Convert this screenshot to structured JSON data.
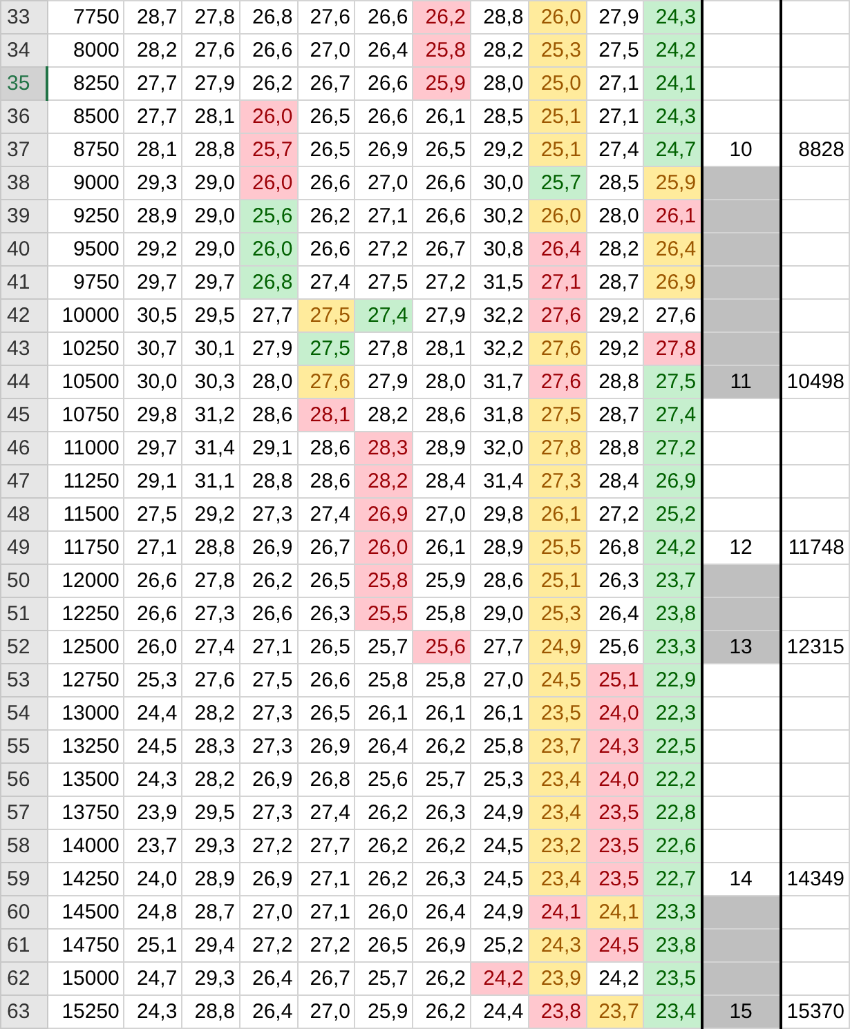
{
  "rows": [
    {
      "header": "33",
      "selected": false,
      "count": "7750",
      "cells": [
        {
          "text": "28,7"
        },
        {
          "text": "27,8"
        },
        {
          "text": "26,8"
        },
        {
          "text": "27,6"
        },
        {
          "text": "26,6"
        },
        {
          "text": "26,2",
          "color": "#ffc7ce"
        },
        {
          "text": "28,8"
        },
        {
          "text": "26,0",
          "color": "#ffeb9c"
        },
        {
          "text": "27,9"
        },
        {
          "text": "24,3",
          "color": "#c6efce"
        }
      ],
      "marker": {
        "shaded": false
      },
      "total": {}
    },
    {
      "header": "34",
      "selected": false,
      "count": "8000",
      "cells": [
        {
          "text": "28,2"
        },
        {
          "text": "27,6"
        },
        {
          "text": "26,6"
        },
        {
          "text": "27,0"
        },
        {
          "text": "26,4"
        },
        {
          "text": "25,8",
          "color": "#ffc7ce"
        },
        {
          "text": "28,2"
        },
        {
          "text": "25,3",
          "color": "#ffeb9c"
        },
        {
          "text": "27,5"
        },
        {
          "text": "24,2",
          "color": "#c6efce"
        }
      ],
      "marker": {
        "shaded": false
      },
      "total": {}
    },
    {
      "header": "35",
      "selected": true,
      "count": "8250",
      "cells": [
        {
          "text": "27,7"
        },
        {
          "text": "27,9"
        },
        {
          "text": "26,2"
        },
        {
          "text": "26,7"
        },
        {
          "text": "26,6"
        },
        {
          "text": "25,9",
          "color": "#ffc7ce"
        },
        {
          "text": "28,0"
        },
        {
          "text": "25,0",
          "color": "#ffeb9c"
        },
        {
          "text": "27,1"
        },
        {
          "text": "24,1",
          "color": "#c6efce"
        }
      ],
      "marker": {
        "shaded": false
      },
      "total": {}
    },
    {
      "header": "36",
      "selected": false,
      "count": "8500",
      "cells": [
        {
          "text": "27,7"
        },
        {
          "text": "28,1"
        },
        {
          "text": "26,0",
          "color": "#ffc7ce"
        },
        {
          "text": "26,5"
        },
        {
          "text": "26,6"
        },
        {
          "text": "26,1"
        },
        {
          "text": "28,5"
        },
        {
          "text": "25,1",
          "color": "#ffeb9c"
        },
        {
          "text": "27,1"
        },
        {
          "text": "24,3",
          "color": "#c6efce"
        }
      ],
      "marker": {
        "shaded": false
      },
      "total": {}
    },
    {
      "header": "37",
      "selected": false,
      "count": "8750",
      "cells": [
        {
          "text": "28,1"
        },
        {
          "text": "28,8"
        },
        {
          "text": "25,7",
          "color": "#ffc7ce"
        },
        {
          "text": "26,5"
        },
        {
          "text": "26,9"
        },
        {
          "text": "26,5"
        },
        {
          "text": "29,2"
        },
        {
          "text": "25,1",
          "color": "#ffeb9c"
        },
        {
          "text": "27,4"
        },
        {
          "text": "24,7",
          "color": "#c6efce"
        }
      ],
      "marker": {
        "text": "10",
        "shaded": false
      },
      "total": {
        "text": "8828"
      }
    },
    {
      "header": "38",
      "selected": false,
      "count": "9000",
      "cells": [
        {
          "text": "29,3"
        },
        {
          "text": "29,0"
        },
        {
          "text": "26,0",
          "color": "#ffc7ce"
        },
        {
          "text": "26,6"
        },
        {
          "text": "27,0"
        },
        {
          "text": "26,6"
        },
        {
          "text": "30,0"
        },
        {
          "text": "25,7",
          "color": "#c6efce"
        },
        {
          "text": "28,5"
        },
        {
          "text": "25,9",
          "color": "#ffeb9c"
        }
      ],
      "marker": {
        "shaded": true
      },
      "total": {}
    },
    {
      "header": "39",
      "selected": false,
      "count": "9250",
      "cells": [
        {
          "text": "28,9"
        },
        {
          "text": "29,0"
        },
        {
          "text": "25,6",
          "color": "#c6efce"
        },
        {
          "text": "26,2"
        },
        {
          "text": "27,1"
        },
        {
          "text": "26,6"
        },
        {
          "text": "30,2"
        },
        {
          "text": "26,0",
          "color": "#ffeb9c"
        },
        {
          "text": "28,0"
        },
        {
          "text": "26,1",
          "color": "#ffc7ce"
        }
      ],
      "marker": {
        "shaded": true
      },
      "total": {}
    },
    {
      "header": "40",
      "selected": false,
      "count": "9500",
      "cells": [
        {
          "text": "29,2"
        },
        {
          "text": "29,0"
        },
        {
          "text": "26,0",
          "color": "#c6efce"
        },
        {
          "text": "26,6"
        },
        {
          "text": "27,2"
        },
        {
          "text": "26,7"
        },
        {
          "text": "30,8"
        },
        {
          "text": "26,4",
          "color": "#ffc7ce"
        },
        {
          "text": "28,2"
        },
        {
          "text": "26,4",
          "color": "#ffeb9c"
        }
      ],
      "marker": {
        "shaded": true
      },
      "total": {}
    },
    {
      "header": "41",
      "selected": false,
      "count": "9750",
      "cells": [
        {
          "text": "29,7"
        },
        {
          "text": "29,7"
        },
        {
          "text": "26,8",
          "color": "#c6efce"
        },
        {
          "text": "27,4"
        },
        {
          "text": "27,5"
        },
        {
          "text": "27,2"
        },
        {
          "text": "31,5"
        },
        {
          "text": "27,1",
          "color": "#ffc7ce"
        },
        {
          "text": "28,7"
        },
        {
          "text": "26,9",
          "color": "#ffeb9c"
        }
      ],
      "marker": {
        "shaded": true
      },
      "total": {}
    },
    {
      "header": "42",
      "selected": false,
      "count": "10000",
      "cells": [
        {
          "text": "30,5"
        },
        {
          "text": "29,5"
        },
        {
          "text": "27,7"
        },
        {
          "text": "27,5",
          "color": "#ffeb9c"
        },
        {
          "text": "27,4",
          "color": "#c6efce"
        },
        {
          "text": "27,9"
        },
        {
          "text": "32,2"
        },
        {
          "text": "27,6",
          "color": "#ffc7ce"
        },
        {
          "text": "29,2"
        },
        {
          "text": "27,6"
        }
      ],
      "marker": {
        "shaded": true
      },
      "total": {}
    },
    {
      "header": "43",
      "selected": false,
      "count": "10250",
      "cells": [
        {
          "text": "30,7"
        },
        {
          "text": "30,1"
        },
        {
          "text": "27,9"
        },
        {
          "text": "27,5",
          "color": "#c6efce"
        },
        {
          "text": "27,8"
        },
        {
          "text": "28,1"
        },
        {
          "text": "32,2"
        },
        {
          "text": "27,6",
          "color": "#ffeb9c"
        },
        {
          "text": "29,2"
        },
        {
          "text": "27,8",
          "color": "#ffc7ce"
        }
      ],
      "marker": {
        "shaded": true
      },
      "total": {}
    },
    {
      "header": "44",
      "selected": false,
      "count": "10500",
      "cells": [
        {
          "text": "30,0"
        },
        {
          "text": "30,3"
        },
        {
          "text": "28,0"
        },
        {
          "text": "27,6",
          "color": "#ffeb9c"
        },
        {
          "text": "27,9"
        },
        {
          "text": "28,0"
        },
        {
          "text": "31,7"
        },
        {
          "text": "27,6",
          "color": "#ffc7ce"
        },
        {
          "text": "28,8"
        },
        {
          "text": "27,5",
          "color": "#c6efce"
        }
      ],
      "marker": {
        "text": "11",
        "shaded": true
      },
      "total": {
        "text": "10498"
      }
    },
    {
      "header": "45",
      "selected": false,
      "count": "10750",
      "cells": [
        {
          "text": "29,8"
        },
        {
          "text": "31,2"
        },
        {
          "text": "28,6"
        },
        {
          "text": "28,1",
          "color": "#ffc7ce"
        },
        {
          "text": "28,2"
        },
        {
          "text": "28,6"
        },
        {
          "text": "31,8"
        },
        {
          "text": "27,5",
          "color": "#ffeb9c"
        },
        {
          "text": "28,7"
        },
        {
          "text": "27,4",
          "color": "#c6efce"
        }
      ],
      "marker": {
        "shaded": false
      },
      "total": {}
    },
    {
      "header": "46",
      "selected": false,
      "count": "11000",
      "cells": [
        {
          "text": "29,7"
        },
        {
          "text": "31,4"
        },
        {
          "text": "29,1"
        },
        {
          "text": "28,6"
        },
        {
          "text": "28,3",
          "color": "#ffc7ce"
        },
        {
          "text": "28,9"
        },
        {
          "text": "32,0"
        },
        {
          "text": "27,8",
          "color": "#ffeb9c"
        },
        {
          "text": "28,8"
        },
        {
          "text": "27,2",
          "color": "#c6efce"
        }
      ],
      "marker": {
        "shaded": false
      },
      "total": {}
    },
    {
      "header": "47",
      "selected": false,
      "count": "11250",
      "cells": [
        {
          "text": "29,1"
        },
        {
          "text": "31,1"
        },
        {
          "text": "28,8"
        },
        {
          "text": "28,6"
        },
        {
          "text": "28,2",
          "color": "#ffc7ce"
        },
        {
          "text": "28,4"
        },
        {
          "text": "31,4"
        },
        {
          "text": "27,3",
          "color": "#ffeb9c"
        },
        {
          "text": "28,4"
        },
        {
          "text": "26,9",
          "color": "#c6efce"
        }
      ],
      "marker": {
        "shaded": false
      },
      "total": {}
    },
    {
      "header": "48",
      "selected": false,
      "count": "11500",
      "cells": [
        {
          "text": "27,5"
        },
        {
          "text": "29,2"
        },
        {
          "text": "27,3"
        },
        {
          "text": "27,4"
        },
        {
          "text": "26,9",
          "color": "#ffc7ce"
        },
        {
          "text": "27,0"
        },
        {
          "text": "29,8"
        },
        {
          "text": "26,1",
          "color": "#ffeb9c"
        },
        {
          "text": "27,2"
        },
        {
          "text": "25,2",
          "color": "#c6efce"
        }
      ],
      "marker": {
        "shaded": false
      },
      "total": {}
    },
    {
      "header": "49",
      "selected": false,
      "count": "11750",
      "cells": [
        {
          "text": "27,1"
        },
        {
          "text": "28,8"
        },
        {
          "text": "26,9"
        },
        {
          "text": "26,7"
        },
        {
          "text": "26,0",
          "color": "#ffc7ce"
        },
        {
          "text": "26,1"
        },
        {
          "text": "28,9"
        },
        {
          "text": "25,5",
          "color": "#ffeb9c"
        },
        {
          "text": "26,8"
        },
        {
          "text": "24,2",
          "color": "#c6efce"
        }
      ],
      "marker": {
        "text": "12",
        "shaded": false
      },
      "total": {
        "text": "11748"
      }
    },
    {
      "header": "50",
      "selected": false,
      "count": "12000",
      "cells": [
        {
          "text": "26,6"
        },
        {
          "text": "27,8"
        },
        {
          "text": "26,2"
        },
        {
          "text": "26,5"
        },
        {
          "text": "25,8",
          "color": "#ffc7ce"
        },
        {
          "text": "25,9"
        },
        {
          "text": "28,6"
        },
        {
          "text": "25,1",
          "color": "#ffeb9c"
        },
        {
          "text": "26,3"
        },
        {
          "text": "23,7",
          "color": "#c6efce"
        }
      ],
      "marker": {
        "shaded": true
      },
      "total": {}
    },
    {
      "header": "51",
      "selected": false,
      "count": "12250",
      "cells": [
        {
          "text": "26,6"
        },
        {
          "text": "27,3"
        },
        {
          "text": "26,6"
        },
        {
          "text": "26,3"
        },
        {
          "text": "25,5",
          "color": "#ffc7ce"
        },
        {
          "text": "25,8"
        },
        {
          "text": "29,0"
        },
        {
          "text": "25,3",
          "color": "#ffeb9c"
        },
        {
          "text": "26,4"
        },
        {
          "text": "23,8",
          "color": "#c6efce"
        }
      ],
      "marker": {
        "shaded": true
      },
      "total": {}
    },
    {
      "header": "52",
      "selected": false,
      "count": "12500",
      "cells": [
        {
          "text": "26,0"
        },
        {
          "text": "27,4"
        },
        {
          "text": "27,1"
        },
        {
          "text": "26,5"
        },
        {
          "text": "25,7"
        },
        {
          "text": "25,6",
          "color": "#ffc7ce"
        },
        {
          "text": "27,7"
        },
        {
          "text": "24,9",
          "color": "#ffeb9c"
        },
        {
          "text": "25,6"
        },
        {
          "text": "23,3",
          "color": "#c6efce"
        }
      ],
      "marker": {
        "text": "13",
        "shaded": true
      },
      "total": {
        "text": "12315"
      }
    },
    {
      "header": "53",
      "selected": false,
      "count": "12750",
      "cells": [
        {
          "text": "25,3"
        },
        {
          "text": "27,6"
        },
        {
          "text": "27,5"
        },
        {
          "text": "26,6"
        },
        {
          "text": "25,8"
        },
        {
          "text": "25,8"
        },
        {
          "text": "27,0"
        },
        {
          "text": "24,5",
          "color": "#ffeb9c"
        },
        {
          "text": "25,1",
          "color": "#ffc7ce"
        },
        {
          "text": "22,9",
          "color": "#c6efce"
        }
      ],
      "marker": {
        "shaded": false
      },
      "total": {}
    },
    {
      "header": "54",
      "selected": false,
      "count": "13000",
      "cells": [
        {
          "text": "24,4"
        },
        {
          "text": "28,2"
        },
        {
          "text": "27,3"
        },
        {
          "text": "26,5"
        },
        {
          "text": "26,1"
        },
        {
          "text": "26,1"
        },
        {
          "text": "26,1"
        },
        {
          "text": "23,5",
          "color": "#ffeb9c"
        },
        {
          "text": "24,0",
          "color": "#ffc7ce"
        },
        {
          "text": "22,3",
          "color": "#c6efce"
        }
      ],
      "marker": {
        "shaded": false
      },
      "total": {}
    },
    {
      "header": "55",
      "selected": false,
      "count": "13250",
      "cells": [
        {
          "text": "24,5"
        },
        {
          "text": "28,3"
        },
        {
          "text": "27,3"
        },
        {
          "text": "26,9"
        },
        {
          "text": "26,4"
        },
        {
          "text": "26,2"
        },
        {
          "text": "25,8"
        },
        {
          "text": "23,7",
          "color": "#ffeb9c"
        },
        {
          "text": "24,3",
          "color": "#ffc7ce"
        },
        {
          "text": "22,5",
          "color": "#c6efce"
        }
      ],
      "marker": {
        "shaded": false
      },
      "total": {}
    },
    {
      "header": "56",
      "selected": false,
      "count": "13500",
      "cells": [
        {
          "text": "24,3"
        },
        {
          "text": "28,2"
        },
        {
          "text": "26,9"
        },
        {
          "text": "26,8"
        },
        {
          "text": "25,6"
        },
        {
          "text": "25,7"
        },
        {
          "text": "25,3"
        },
        {
          "text": "23,4",
          "color": "#ffeb9c"
        },
        {
          "text": "24,0",
          "color": "#ffc7ce"
        },
        {
          "text": "22,2",
          "color": "#c6efce"
        }
      ],
      "marker": {
        "shaded": false
      },
      "total": {}
    },
    {
      "header": "57",
      "selected": false,
      "count": "13750",
      "cells": [
        {
          "text": "23,9"
        },
        {
          "text": "29,5"
        },
        {
          "text": "27,3"
        },
        {
          "text": "27,4"
        },
        {
          "text": "26,2"
        },
        {
          "text": "26,3"
        },
        {
          "text": "24,9"
        },
        {
          "text": "23,4",
          "color": "#ffeb9c"
        },
        {
          "text": "23,5",
          "color": "#ffc7ce"
        },
        {
          "text": "22,8",
          "color": "#c6efce"
        }
      ],
      "marker": {
        "shaded": false
      },
      "total": {}
    },
    {
      "header": "58",
      "selected": false,
      "count": "14000",
      "cells": [
        {
          "text": "23,7"
        },
        {
          "text": "29,3"
        },
        {
          "text": "27,2"
        },
        {
          "text": "27,7"
        },
        {
          "text": "26,2"
        },
        {
          "text": "26,2"
        },
        {
          "text": "24,5"
        },
        {
          "text": "23,2",
          "color": "#ffeb9c"
        },
        {
          "text": "23,5",
          "color": "#ffc7ce"
        },
        {
          "text": "22,6",
          "color": "#c6efce"
        }
      ],
      "marker": {
        "shaded": false
      },
      "total": {}
    },
    {
      "header": "59",
      "selected": false,
      "count": "14250",
      "cells": [
        {
          "text": "24,0"
        },
        {
          "text": "28,9"
        },
        {
          "text": "26,9"
        },
        {
          "text": "27,1"
        },
        {
          "text": "26,2"
        },
        {
          "text": "26,3"
        },
        {
          "text": "24,5"
        },
        {
          "text": "23,4",
          "color": "#ffeb9c"
        },
        {
          "text": "23,5",
          "color": "#ffc7ce"
        },
        {
          "text": "22,7",
          "color": "#c6efce"
        }
      ],
      "marker": {
        "text": "14",
        "shaded": false
      },
      "total": {
        "text": "14349"
      }
    },
    {
      "header": "60",
      "selected": false,
      "count": "14500",
      "cells": [
        {
          "text": "24,8"
        },
        {
          "text": "28,7"
        },
        {
          "text": "27,0"
        },
        {
          "text": "27,1"
        },
        {
          "text": "26,0"
        },
        {
          "text": "26,4"
        },
        {
          "text": "24,9"
        },
        {
          "text": "24,1",
          "color": "#ffc7ce"
        },
        {
          "text": "24,1",
          "color": "#ffeb9c"
        },
        {
          "text": "23,3",
          "color": "#c6efce"
        }
      ],
      "marker": {
        "shaded": true
      },
      "total": {}
    },
    {
      "header": "61",
      "selected": false,
      "count": "14750",
      "cells": [
        {
          "text": "25,1"
        },
        {
          "text": "29,4"
        },
        {
          "text": "27,2"
        },
        {
          "text": "27,2"
        },
        {
          "text": "26,5"
        },
        {
          "text": "26,9"
        },
        {
          "text": "25,2"
        },
        {
          "text": "24,3",
          "color": "#ffeb9c"
        },
        {
          "text": "24,5",
          "color": "#ffc7ce"
        },
        {
          "text": "23,8",
          "color": "#c6efce"
        }
      ],
      "marker": {
        "shaded": true
      },
      "total": {}
    },
    {
      "header": "62",
      "selected": false,
      "count": "15000",
      "cells": [
        {
          "text": "24,7"
        },
        {
          "text": "29,3"
        },
        {
          "text": "26,4"
        },
        {
          "text": "26,7"
        },
        {
          "text": "25,7"
        },
        {
          "text": "26,2"
        },
        {
          "text": "24,2",
          "color": "#ffc7ce"
        },
        {
          "text": "23,9",
          "color": "#ffeb9c"
        },
        {
          "text": "24,2"
        },
        {
          "text": "23,5",
          "color": "#c6efce"
        }
      ],
      "marker": {
        "shaded": true
      },
      "total": {}
    },
    {
      "header": "63",
      "selected": false,
      "count": "15250",
      "cells": [
        {
          "text": "24,3"
        },
        {
          "text": "28,8"
        },
        {
          "text": "26,4"
        },
        {
          "text": "27,0"
        },
        {
          "text": "25,9"
        },
        {
          "text": "26,2"
        },
        {
          "text": "24,4"
        },
        {
          "text": "23,8",
          "color": "#ffc7ce"
        },
        {
          "text": "23,7",
          "color": "#ffeb9c"
        },
        {
          "text": "23,4",
          "color": "#c6efce"
        }
      ],
      "marker": {
        "text": "15",
        "shaded": true
      },
      "total": {
        "text": "15370"
      }
    }
  ]
}
